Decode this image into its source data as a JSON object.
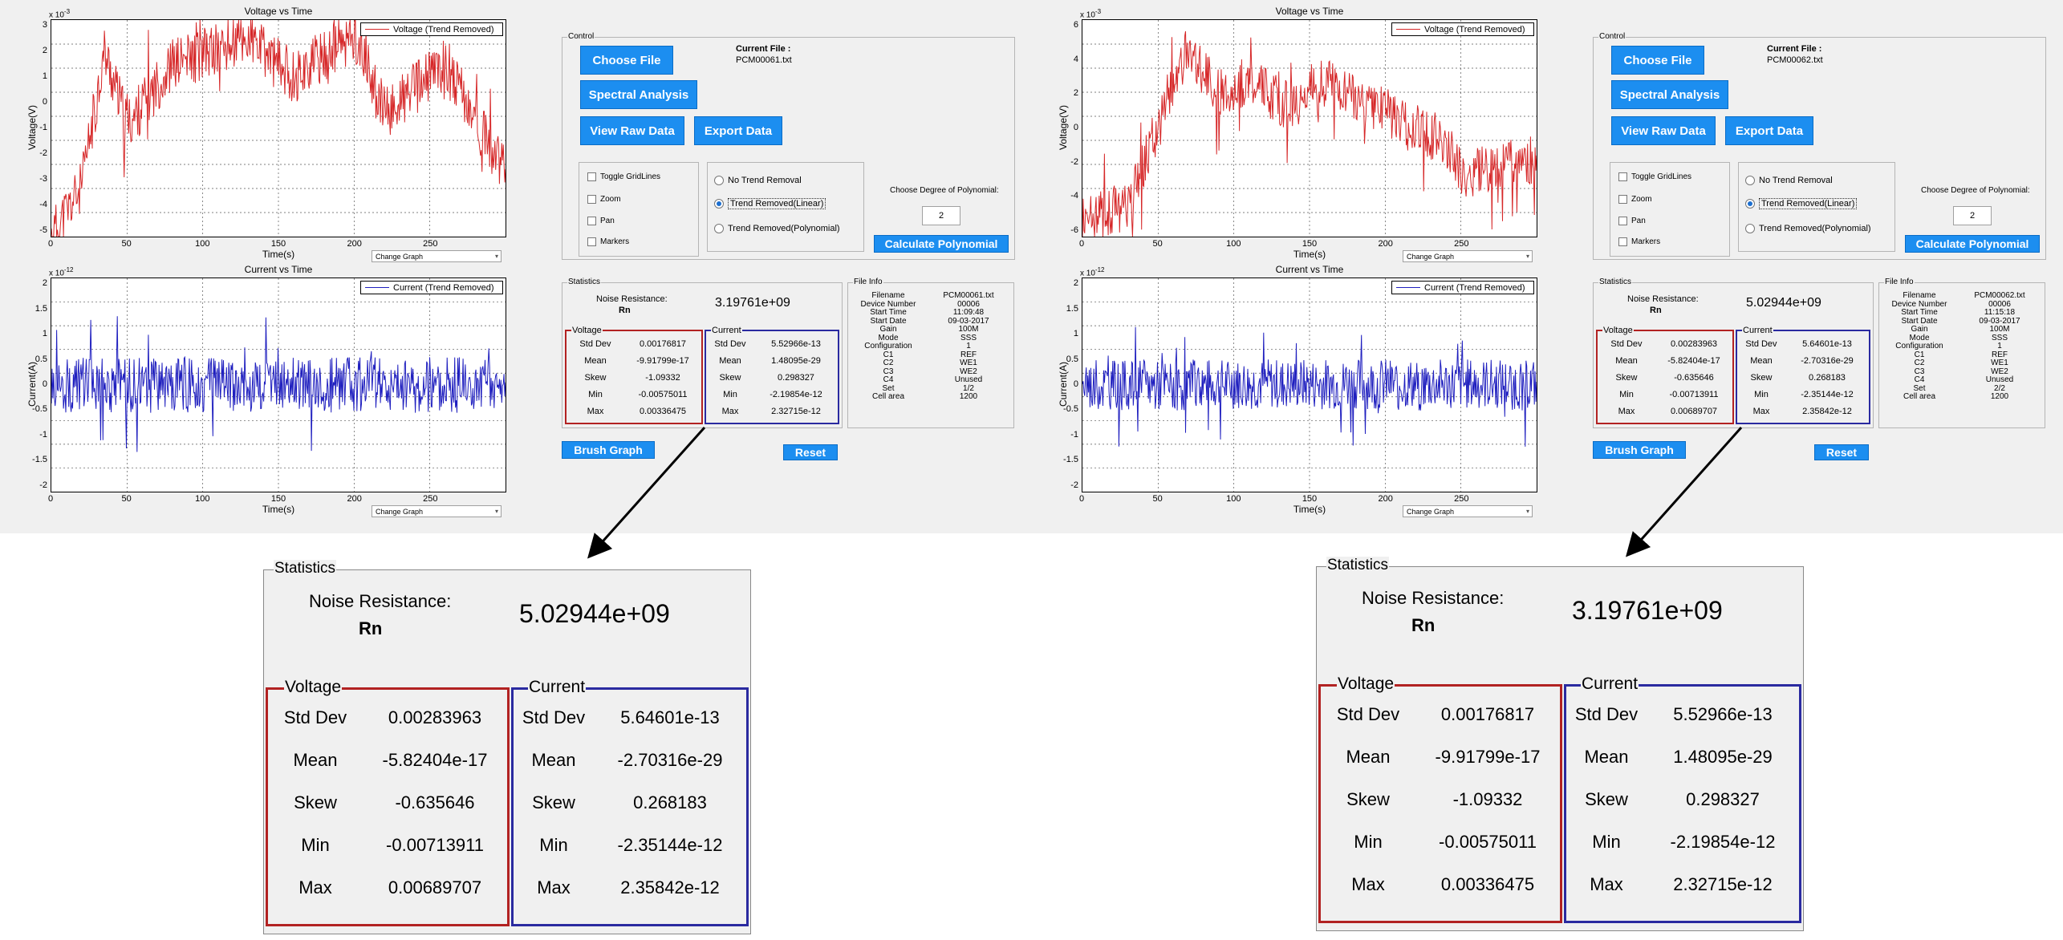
{
  "app_left": {
    "voltage_chart": {
      "title": "Voltage vs Time",
      "xlabel": "Time(s)",
      "ylabel": "Voltage(V)",
      "exponent_text": "x 10",
      "exponent_power": "-3",
      "legend": "Voltage (Trend Removed)",
      "yticks": [
        "3",
        "2",
        "1",
        "0",
        "-1",
        "-2",
        "-3",
        "-4",
        "-5"
      ],
      "xticks": [
        "0",
        "50",
        "100",
        "150",
        "200",
        "250"
      ],
      "change_graph": "Change Graph"
    },
    "current_chart": {
      "title": "Current vs Time",
      "xlabel": "Time(s)",
      "ylabel": "Current(A)",
      "exponent_text": "x 10",
      "exponent_power": "-12",
      "legend": "Current (Trend Removed)",
      "yticks": [
        "2",
        "1.5",
        "1",
        "0.5",
        "0",
        "-0.5",
        "-1",
        "-1.5",
        "-2"
      ],
      "xticks": [
        "0",
        "50",
        "100",
        "150",
        "200",
        "250"
      ],
      "change_graph": "Change Graph"
    },
    "control": {
      "title": "Control",
      "choose_file": "Choose File",
      "spectral": "Spectral Analysis",
      "view_raw": "View Raw Data",
      "export": "Export Data",
      "current_file_label": "Current File :",
      "current_file": "PCM00061.txt",
      "toggle_grid": "Toggle GridLines",
      "zoom": "Zoom",
      "pan": "Pan",
      "markers": "Markers",
      "no_trend": "No Trend Removal",
      "trend_linear": "Trend Removed(Linear)",
      "trend_poly": "Trend Removed(Polynomial)",
      "degree_label": "Choose Degree of Polynomial:",
      "degree_value": "2",
      "calc_poly": "Calculate Polynomial"
    },
    "stats": {
      "title": "Statistics",
      "noise_label": "Noise Resistance:",
      "rn_label": "Rn",
      "rn_value": "3.19761e+09",
      "voltage_title": "Voltage",
      "current_title": "Current",
      "voltage": [
        {
          "k": "Std Dev",
          "v": "0.00176817"
        },
        {
          "k": "Mean",
          "v": "-9.91799e-17"
        },
        {
          "k": "Skew",
          "v": "-1.09332"
        },
        {
          "k": "Min",
          "v": "-0.00575011"
        },
        {
          "k": "Max",
          "v": "0.00336475"
        }
      ],
      "current": [
        {
          "k": "Std Dev",
          "v": "5.52966e-13"
        },
        {
          "k": "Mean",
          "v": "1.48095e-29"
        },
        {
          "k": "Skew",
          "v": "0.298327"
        },
        {
          "k": "Min",
          "v": "-2.19854e-12"
        },
        {
          "k": "Max",
          "v": "2.32715e-12"
        }
      ]
    },
    "fileinfo": {
      "title": "File Info",
      "rows": [
        {
          "k": "Filename",
          "v": "PCM00061.txt"
        },
        {
          "k": "Device Number",
          "v": "00006"
        },
        {
          "k": "Start Time",
          "v": "11:09:48"
        },
        {
          "k": "Start Date",
          "v": "09-03-2017"
        },
        {
          "k": "Gain",
          "v": "100M"
        },
        {
          "k": "Mode",
          "v": "SSS"
        },
        {
          "k": "Configuration",
          "v": "1"
        },
        {
          "k": "C1",
          "v": "REF"
        },
        {
          "k": "C2",
          "v": "WE1"
        },
        {
          "k": "C3",
          "v": "WE2"
        },
        {
          "k": "C4",
          "v": "Unused"
        },
        {
          "k": "Set",
          "v": "1/2"
        },
        {
          "k": "Cell area",
          "v": "1200"
        }
      ]
    },
    "brush": "Brush Graph",
    "reset": "Reset"
  },
  "app_right": {
    "voltage_chart": {
      "title": "Voltage vs Time",
      "xlabel": "Time(s)",
      "ylabel": "Voltage(V)",
      "exponent_text": "x 10",
      "exponent_power": "-3",
      "legend": "Voltage (Trend Removed)",
      "yticks": [
        "6",
        "4",
        "2",
        "0",
        "-2",
        "-4",
        "-6"
      ],
      "xticks": [
        "0",
        "50",
        "100",
        "150",
        "200",
        "250"
      ],
      "change_graph": "Change Graph"
    },
    "current_chart": {
      "title": "Current vs Time",
      "xlabel": "Time(s)",
      "ylabel": "Current(A)",
      "exponent_text": "x 10",
      "exponent_power": "-12",
      "legend": "Current (Trend Removed)",
      "yticks": [
        "2",
        "1.5",
        "1",
        "0.5",
        "0",
        "-0.5",
        "-1",
        "-1.5",
        "-2"
      ],
      "xticks": [
        "0",
        "50",
        "100",
        "150",
        "200",
        "250"
      ],
      "change_graph": "Change Graph"
    },
    "control": {
      "title": "Control",
      "choose_file": "Choose File",
      "spectral": "Spectral Analysis",
      "view_raw": "View Raw Data",
      "export": "Export Data",
      "current_file_label": "Current File :",
      "current_file": "PCM00062.txt",
      "toggle_grid": "Toggle GridLines",
      "zoom": "Zoom",
      "pan": "Pan",
      "markers": "Markers",
      "no_trend": "No Trend Removal",
      "trend_linear": "Trend Removed(Linear)",
      "trend_poly": "Trend Removed(Polynomial)",
      "degree_label": "Choose Degree of Polynomial:",
      "degree_value": "2",
      "calc_poly": "Calculate Polynomial"
    },
    "stats": {
      "title": "Statistics",
      "noise_label": "Noise Resistance:",
      "rn_label": "Rn",
      "rn_value": "5.02944e+09",
      "voltage_title": "Voltage",
      "current_title": "Current",
      "voltage": [
        {
          "k": "Std Dev",
          "v": "0.00283963"
        },
        {
          "k": "Mean",
          "v": "-5.82404e-17"
        },
        {
          "k": "Skew",
          "v": "-0.635646"
        },
        {
          "k": "Min",
          "v": "-0.00713911"
        },
        {
          "k": "Max",
          "v": "0.00689707"
        }
      ],
      "current": [
        {
          "k": "Std Dev",
          "v": "5.64601e-13"
        },
        {
          "k": "Mean",
          "v": "-2.70316e-29"
        },
        {
          "k": "Skew",
          "v": "0.268183"
        },
        {
          "k": "Min",
          "v": "-2.35144e-12"
        },
        {
          "k": "Max",
          "v": "2.35842e-12"
        }
      ]
    },
    "fileinfo": {
      "title": "File Info",
      "rows": [
        {
          "k": "Filename",
          "v": "PCM00062.txt"
        },
        {
          "k": "Device Number",
          "v": "00006"
        },
        {
          "k": "Start Time",
          "v": "11:15:18"
        },
        {
          "k": "Start Date",
          "v": "09-03-2017"
        },
        {
          "k": "Gain",
          "v": "100M"
        },
        {
          "k": "Mode",
          "v": "SSS"
        },
        {
          "k": "Configuration",
          "v": "1"
        },
        {
          "k": "C1",
          "v": "REF"
        },
        {
          "k": "C2",
          "v": "WE1"
        },
        {
          "k": "C3",
          "v": "WE2"
        },
        {
          "k": "C4",
          "v": "Unused"
        },
        {
          "k": "Set",
          "v": "2/2"
        },
        {
          "k": "Cell area",
          "v": "1200"
        }
      ]
    },
    "brush": "Brush Graph",
    "reset": "Reset"
  },
  "zoom_left": {
    "title": "Statistics",
    "noise_label": "Noise Resistance:",
    "rn_label": "Rn",
    "rn_value": "5.02944e+09",
    "voltage_title": "Voltage",
    "current_title": "Current",
    "voltage": [
      {
        "k": "Std Dev",
        "v": "0.00283963"
      },
      {
        "k": "Mean",
        "v": "-5.82404e-17"
      },
      {
        "k": "Skew",
        "v": "-0.635646"
      },
      {
        "k": "Min",
        "v": "-0.00713911"
      },
      {
        "k": "Max",
        "v": "0.00689707"
      }
    ],
    "current": [
      {
        "k": "Std Dev",
        "v": "5.64601e-13"
      },
      {
        "k": "Mean",
        "v": "-2.70316e-29"
      },
      {
        "k": "Skew",
        "v": "0.268183"
      },
      {
        "k": "Min",
        "v": "-2.35144e-12"
      },
      {
        "k": "Max",
        "v": "2.35842e-12"
      }
    ]
  },
  "zoom_right": {
    "title": "Statistics",
    "noise_label": "Noise Resistance:",
    "rn_label": "Rn",
    "rn_value": "3.19761e+09",
    "voltage_title": "Voltage",
    "current_title": "Current",
    "voltage": [
      {
        "k": "Std Dev",
        "v": "0.00176817"
      },
      {
        "k": "Mean",
        "v": "-9.91799e-17"
      },
      {
        "k": "Skew",
        "v": "-1.09332"
      },
      {
        "k": "Min",
        "v": "-0.00575011"
      },
      {
        "k": "Max",
        "v": "0.00336475"
      }
    ],
    "current": [
      {
        "k": "Std Dev",
        "v": "5.52966e-13"
      },
      {
        "k": "Mean",
        "v": "1.48095e-29"
      },
      {
        "k": "Skew",
        "v": "0.298327"
      },
      {
        "k": "Min",
        "v": "-2.19854e-12"
      },
      {
        "k": "Max",
        "v": "2.32715e-12"
      }
    ]
  },
  "colors": {
    "voltage_line": "#d62728",
    "current_line": "#1f1fbf",
    "button": "#1c8ef0",
    "voltage_box": "#b22222",
    "current_box": "#2a2aa0"
  },
  "chart_data": [
    {
      "type": "line",
      "title": "Voltage vs Time",
      "xlabel": "Time(s)",
      "ylabel": "Voltage(V)",
      "xlim": [
        0,
        300
      ],
      "ylim": [
        -5.5,
        3.3
      ],
      "series": [
        {
          "name": "Voltage (Trend Removed)",
          "seed": 11,
          "scale": 1.1,
          "trend": [
            [
              0,
              -5.5
            ],
            [
              20,
              -3.5
            ],
            [
              35,
              2
            ],
            [
              50,
              -1
            ],
            [
              80,
              1.5
            ],
            [
              130,
              2.5
            ],
            [
              160,
              1
            ],
            [
              200,
              2.7
            ],
            [
              220,
              -0.5
            ],
            [
              260,
              1.5
            ],
            [
              300,
              -3
            ]
          ]
        }
      ]
    },
    {
      "type": "line",
      "title": "Current vs Time",
      "xlabel": "Time(s)",
      "ylabel": "Current(A)",
      "xlim": [
        0,
        300
      ],
      "ylim": [
        -2.3,
        2.3
      ],
      "series": [
        {
          "name": "Current (Trend Removed)",
          "seed": 29,
          "scale": 0.6,
          "trend": [
            [
              0,
              0
            ],
            [
              300,
              0
            ]
          ]
        }
      ]
    },
    {
      "type": "line",
      "title": "Voltage vs Time",
      "xlabel": "Time(s)",
      "ylabel": "Voltage(V)",
      "xlim": [
        0,
        300
      ],
      "ylim": [
        -7,
        6.8
      ],
      "series": [
        {
          "name": "Voltage (Trend Removed)",
          "seed": 47,
          "scale": 1.6,
          "trend": [
            [
              0,
              -6
            ],
            [
              30,
              -5
            ],
            [
              50,
              0
            ],
            [
              70,
              5
            ],
            [
              90,
              2
            ],
            [
              110,
              3
            ],
            [
              140,
              1
            ],
            [
              155,
              3
            ],
            [
              190,
              1.5
            ],
            [
              240,
              -1
            ],
            [
              250,
              -3
            ],
            [
              300,
              -2
            ]
          ]
        }
      ]
    },
    {
      "type": "line",
      "title": "Current vs Time",
      "xlabel": "Time(s)",
      "ylabel": "Current(A)",
      "xlim": [
        0,
        300
      ],
      "ylim": [
        -2.3,
        2.3
      ],
      "series": [
        {
          "name": "Current (Trend Removed)",
          "seed": 83,
          "scale": 0.55,
          "trend": [
            [
              0,
              0
            ],
            [
              300,
              0
            ]
          ]
        }
      ]
    }
  ]
}
